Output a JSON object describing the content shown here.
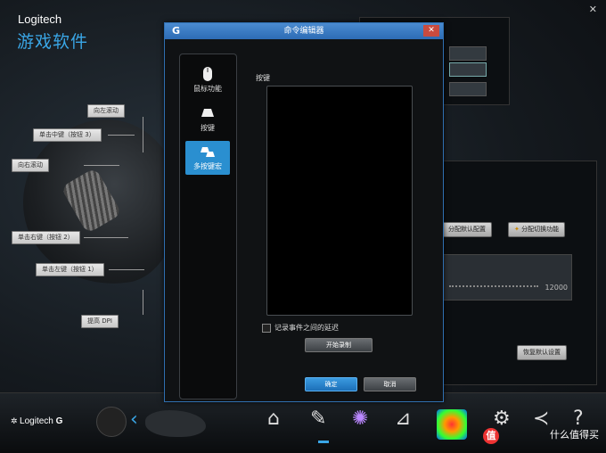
{
  "app": {
    "brand": "Logitech",
    "subtitle": "游戏软件",
    "close": "✕"
  },
  "mouse_labels": [
    "向左滚动",
    "单击中键（按钮 3）",
    "向右滚动",
    "单击右键（按钮 2）",
    "单击左键（按钮 1）",
    "提高 DPI"
  ],
  "right_panel": {
    "btn_default": "分配默认配置",
    "btn_switch": "分配切换功能",
    "slider_value": "12000",
    "btn_restore": "恢复默认设置"
  },
  "dialog": {
    "icon": "G",
    "title": "命令编辑器",
    "close": "✕",
    "nav": [
      {
        "label": "鼠标功能",
        "icon": "mouse-icon"
      },
      {
        "label": "按键",
        "icon": "key-icon"
      },
      {
        "label": "多按键宏",
        "icon": "multikey-icon"
      }
    ],
    "keys_label": "按键",
    "record_delay_label": "记录事件之间的延迟",
    "start_record": "开始录制",
    "ok": "确定",
    "cancel": "取消"
  },
  "bottom": {
    "brand": "Logitech",
    "g": "G",
    "chevron": "‹",
    "watermark": "什么值得买",
    "watermark_badge": "值"
  },
  "colors": {
    "accent": "#2a8fd0",
    "title_bar": "#3c7ec4",
    "close": "#c94b3f"
  }
}
